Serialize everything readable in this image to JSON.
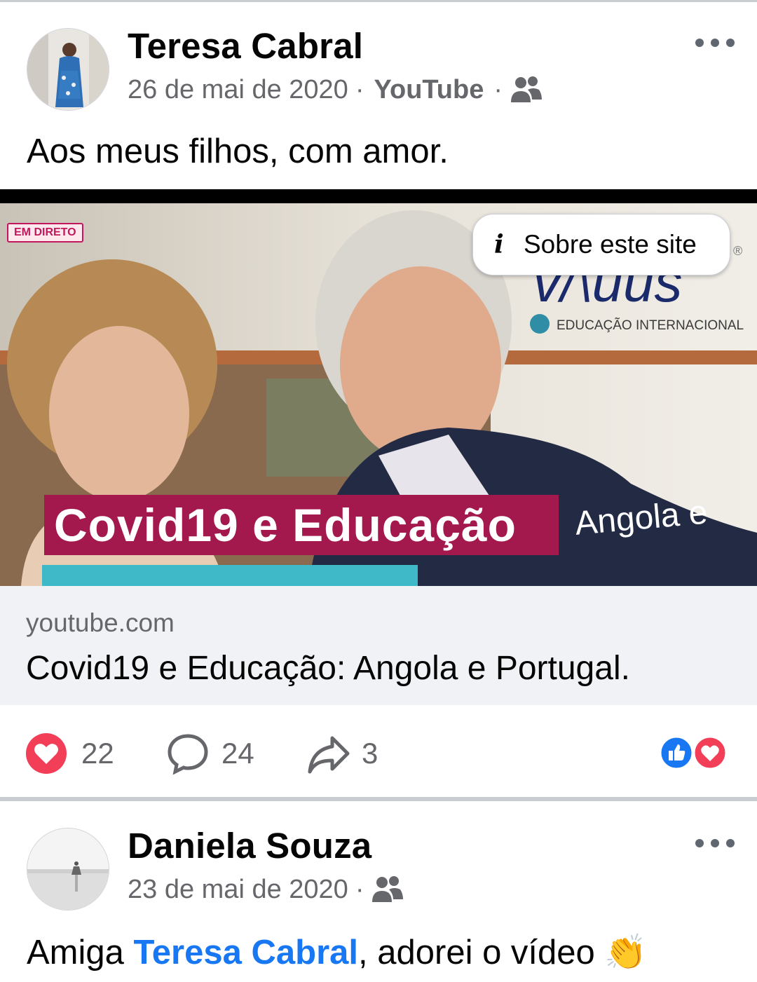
{
  "post": {
    "author": "Teresa Cabral",
    "date": "26 de mai de 2020",
    "separator": "·",
    "source": "YouTube",
    "audience_icon": "friends-icon",
    "text": "Aos meus filhos, com amor.",
    "media": {
      "live_badge": "EM DIRETO",
      "site_info_button": "Sobre este site",
      "overlay_title": "Covid19 e Educação",
      "overlay_subtitle": "Angola e",
      "brand_text": "EDUCAÇÃO INTERNACIONAL"
    },
    "link": {
      "domain": "youtube.com",
      "title": "Covid19 e Educação: Angola e Portugal."
    },
    "actions": {
      "reactions_count": "22",
      "comments_count": "24",
      "shares_count": "3"
    },
    "colors": {
      "accent": "#1877f2",
      "love": "#f33e58",
      "badge": "#a3184d"
    }
  },
  "next_post": {
    "author": "Daniela Souza",
    "date": "23 de mai de 2020",
    "separator": "·",
    "audience_icon": "friends-icon",
    "text_before": "Amiga ",
    "mention": "Teresa Cabral",
    "text_after": ", adorei o vídeo ",
    "emoji": "👏"
  }
}
